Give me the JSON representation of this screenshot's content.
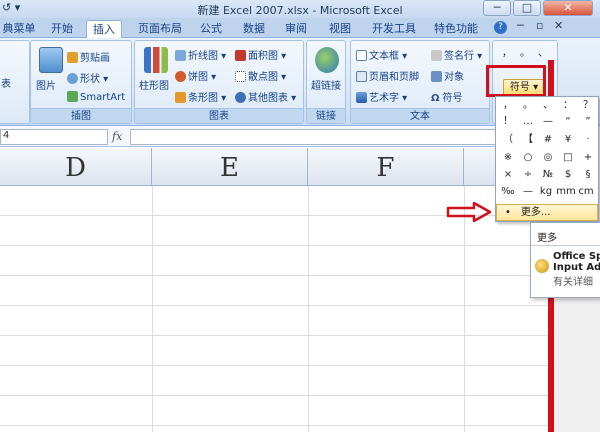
{
  "window": {
    "title": "新建 Excel 2007.xlsx - Microsoft Excel",
    "qa_glyph": "↺ ▾"
  },
  "tabs": [
    {
      "label": "典菜单"
    },
    {
      "label": "开始"
    },
    {
      "label": "插入"
    },
    {
      "label": "页面布局"
    },
    {
      "label": "公式"
    },
    {
      "label": "数据"
    },
    {
      "label": "审阅"
    },
    {
      "label": "视图"
    },
    {
      "label": "开发工具"
    },
    {
      "label": "特色功能"
    }
  ],
  "ribbon": {
    "table_partial": "表",
    "illustrations": {
      "caption": "插图",
      "picture": "图片",
      "clipart": "剪贴画",
      "shapes": "形状 ▾",
      "smartart": "SmartArt"
    },
    "charts": {
      "caption": "图表",
      "column": "柱形图",
      "line": "折线图 ▾",
      "pie": "饼图 ▾",
      "bar": "条形图 ▾",
      "area": "面积图 ▾",
      "scatter": "散点图 ▾",
      "other": "其他图表 ▾"
    },
    "links": {
      "caption": "链接",
      "hyperlink": "超链接"
    },
    "text": {
      "caption": "文本",
      "textbox": "文本框 ▾",
      "header_footer": "页眉和页脚",
      "wordart": "艺术字 ▾",
      "signature": "签名行 ▾",
      "object": "对象",
      "symbol": "符号"
    },
    "symbol_button": "符号 ▾"
  },
  "formula_bar": {
    "namebox": "4",
    "fx": "fx"
  },
  "columns": [
    "D",
    "E",
    "F"
  ],
  "symbols": {
    "row1": [
      "，",
      "。",
      "、"
    ],
    "row2": [
      "，",
      "。",
      "、",
      "：",
      "？"
    ],
    "row3": [
      "！",
      "…",
      "—",
      "“",
      "”"
    ],
    "row4": [
      "（",
      "【",
      "#",
      "¥",
      "·"
    ],
    "row5": [
      "※",
      "○",
      "◎",
      "□",
      "+"
    ],
    "row6": [
      "×",
      "÷",
      "№",
      "$",
      "§"
    ],
    "row7": [
      "‰",
      "—",
      "kg",
      "mm",
      "cm"
    ],
    "more": "更多...",
    "more_bullet": "•"
  },
  "submenu": {
    "title": "更多",
    "item_name_1": "Office Sp",
    "item_name_2": "Input Ad",
    "item_desc": "有关详细"
  }
}
